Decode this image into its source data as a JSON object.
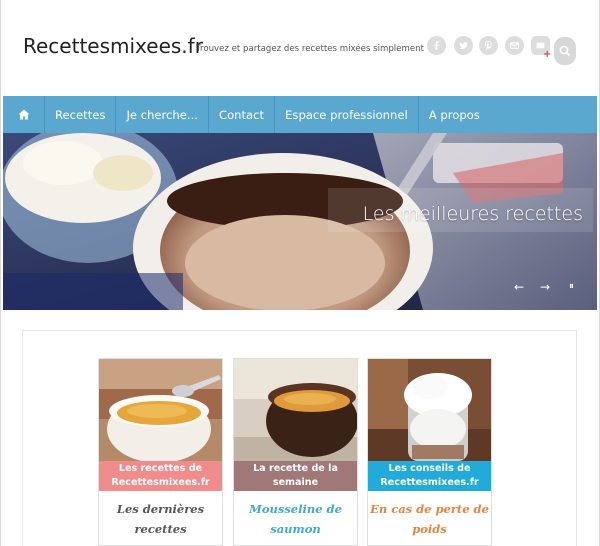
{
  "header": {
    "site_title": "Recettesmixees.fr",
    "tagline": "Trouvez et partagez des recettes mixées simplement",
    "social_icons": [
      "facebook-icon",
      "twitter-icon",
      "pinterest-icon",
      "email-icon",
      "newsletter-icon",
      "search-icon"
    ]
  },
  "nav": {
    "items": [
      "Recettes",
      "Je cherche...",
      "Contact",
      "Espace professionnel",
      "A propos"
    ]
  },
  "hero": {
    "caption": "Les meilleures recettes",
    "controls": [
      "←",
      "→",
      "⏸"
    ]
  },
  "cards": [
    {
      "banner": "Les recettes de Recettesmixees.fr",
      "title": "Les dernières recettes",
      "banner_color": "#f08c8c",
      "title_color": "#555555"
    },
    {
      "banner": "La recette de la semaine",
      "banner_color": "#a07878",
      "title": "Mousseline de saumon",
      "title_color": "#3fa8d6"
    },
    {
      "banner": "Les conseils de Recettesmixees.fr",
      "banner_color": "#22aad8",
      "title": "En cas de perte de poids",
      "title_color": "#e8823c"
    }
  ],
  "colors": {
    "nav_bg": "#5aa8cf",
    "icon_gray": "#dddddd"
  }
}
